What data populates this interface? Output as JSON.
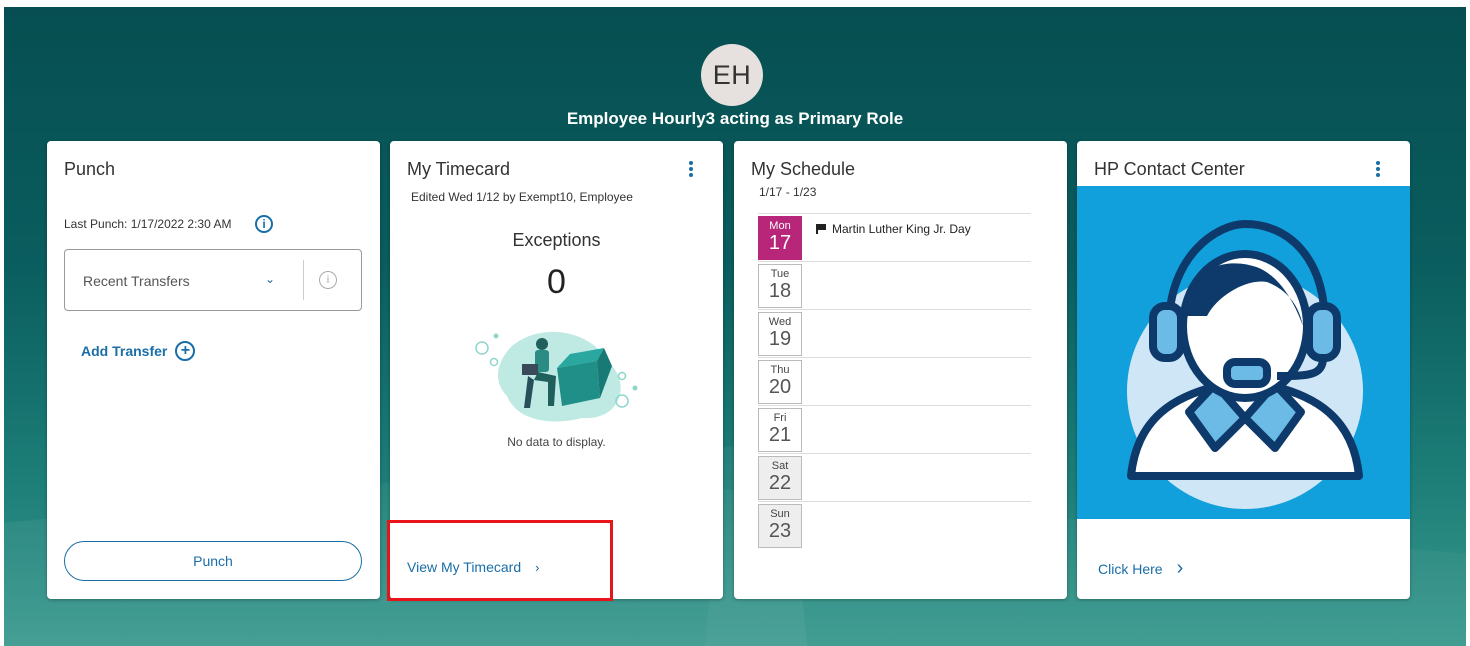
{
  "header": {
    "avatar_initials": "EH",
    "user_line": "Employee Hourly3 acting as Primary Role"
  },
  "punch_card": {
    "title": "Punch",
    "last_punch": "Last Punch: 1/17/2022 2:30 AM",
    "info_glyph": "i",
    "transfers_dropdown": "Recent Transfers",
    "add_transfer": "Add Transfer",
    "plus_glyph": "+",
    "punch_button": "Punch"
  },
  "timecard_card": {
    "title": "My Timecard",
    "edited": "Edited Wed 1/12 by Exempt10, Employee",
    "exceptions_label": "Exceptions",
    "exceptions_value": "0",
    "no_data": "No data to display.",
    "view_link": "View My Timecard",
    "chevron": "›"
  },
  "schedule_card": {
    "title": "My Schedule",
    "range": "1/17 - 1/23",
    "days": [
      {
        "name": "Mon",
        "num": "17",
        "event": "Martin Luther King Jr. Day"
      },
      {
        "name": "Tue",
        "num": "18"
      },
      {
        "name": "Wed",
        "num": "19"
      },
      {
        "name": "Thu",
        "num": "20"
      },
      {
        "name": "Fri",
        "num": "21"
      },
      {
        "name": "Sat",
        "num": "22"
      },
      {
        "name": "Sun",
        "num": "23"
      }
    ]
  },
  "contact_card": {
    "title": "HP Contact Center",
    "link": "Click Here",
    "chevron": "›"
  },
  "colors": {
    "accent": "#1a6ea8",
    "today": "#b8267a",
    "contact_bg": "#11a0dc",
    "highlight_box": "#e8141a"
  },
  "icons": [
    "info-icon",
    "chevron-down-icon",
    "plus-circle-icon",
    "kebab-menu-icon",
    "flag-icon",
    "chevron-right-icon",
    "headset-agent-icon"
  ]
}
